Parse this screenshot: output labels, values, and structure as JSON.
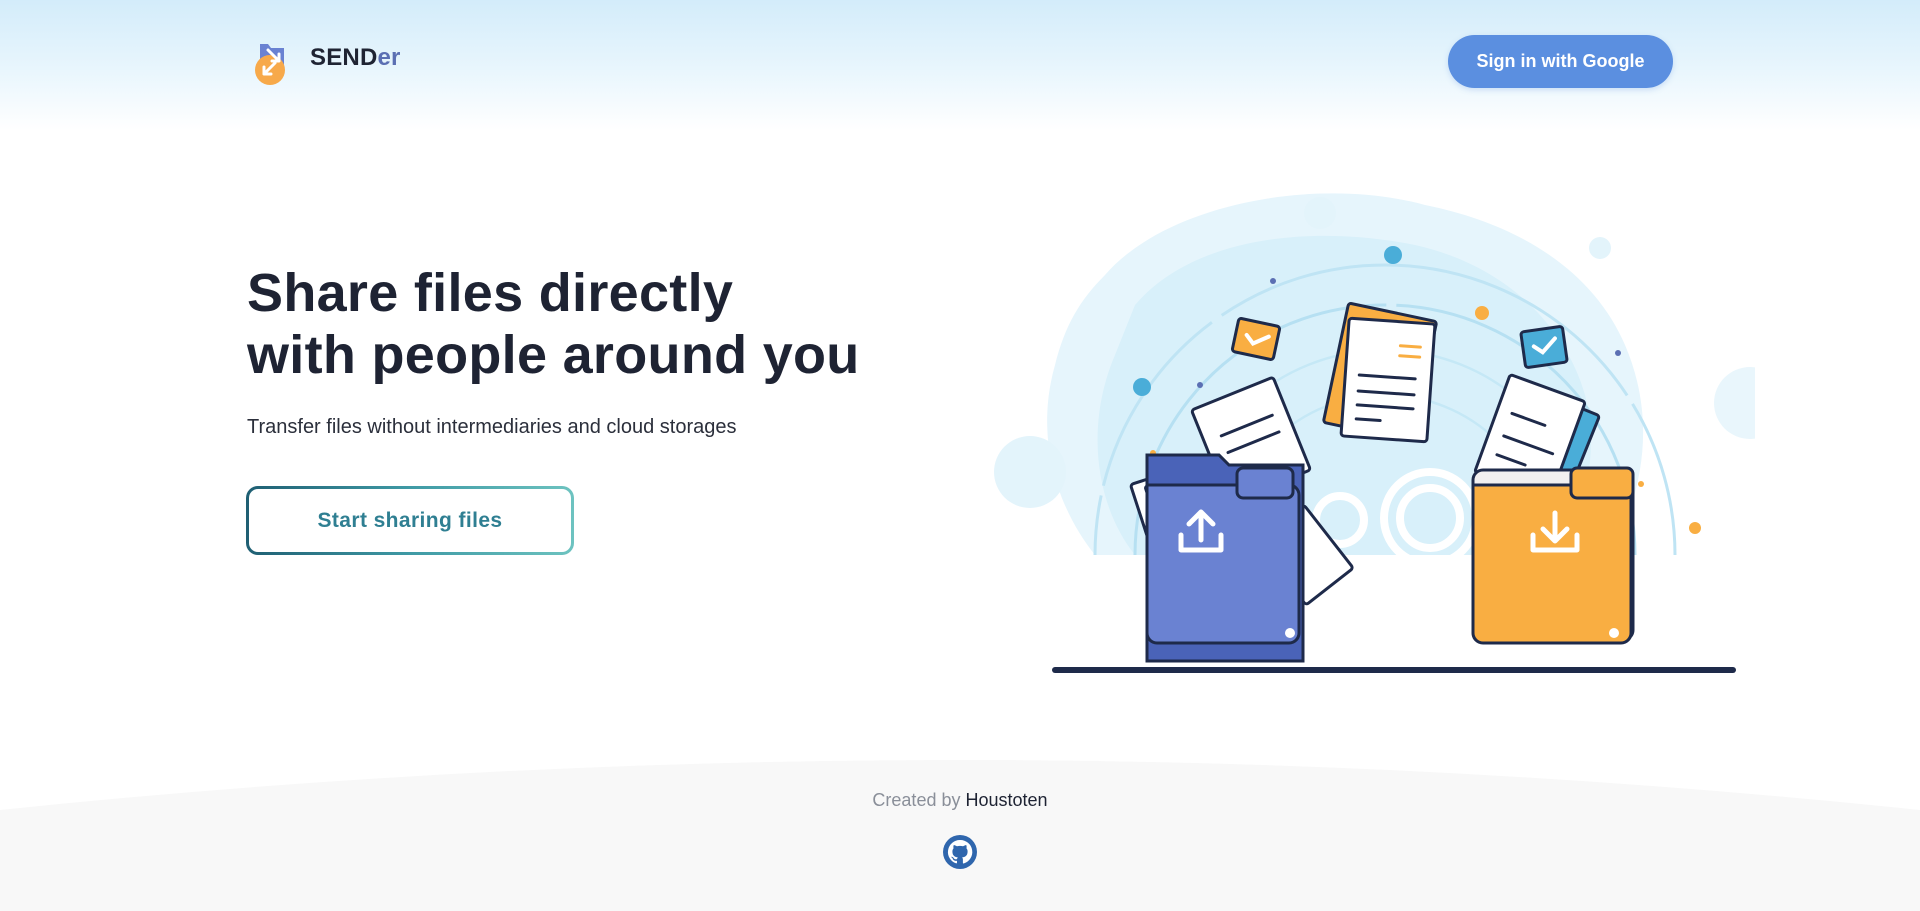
{
  "header": {
    "logo_main": "SEND",
    "logo_suffix": "er",
    "signin_label": "Sign in with Google"
  },
  "hero": {
    "title_line1": "Share files directly",
    "title_line2": "with people around you",
    "subtitle": "Transfer files without intermediaries and cloud storages",
    "cta_label": "Start sharing files"
  },
  "footer": {
    "created_by": "Created by",
    "author": "Houstoten",
    "github_icon": "github-icon"
  },
  "colors": {
    "primary_blue": "#5b8fe0",
    "folder_blue": "#6a82d2",
    "folder_orange": "#f9ae42",
    "accent_cyan": "#4aadd8",
    "dark_text": "#1e2333"
  },
  "icons": [
    "logo-icon",
    "upload-icon",
    "download-icon",
    "checkmark-icon",
    "gear-icon",
    "github-icon"
  ]
}
